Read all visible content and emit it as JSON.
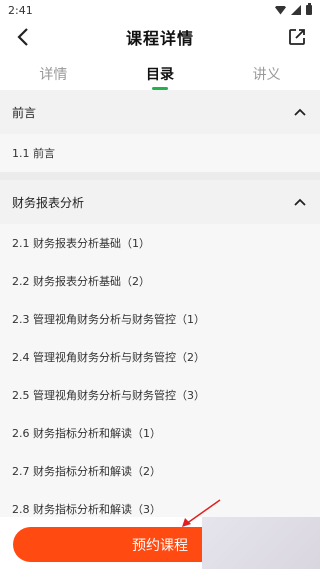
{
  "status": {
    "time": "2:41"
  },
  "header": {
    "title": "课程详情"
  },
  "tabs": [
    {
      "label": "详情"
    },
    {
      "label": "目录"
    },
    {
      "label": "讲义"
    }
  ],
  "sections": [
    {
      "title": "前言",
      "items": [
        "1.1 前言"
      ]
    },
    {
      "title": "财务报表分析",
      "items": [
        "2.1 财务报表分析基础（1）",
        "2.2 财务报表分析基础（2）",
        "2.3 管理视角财务分析与财务管控（1）",
        "2.4 管理视角财务分析与财务管控（2）",
        "2.5 管理视角财务分析与财务管控（3）",
        "2.6 财务指标分析和解读（1）",
        "2.7 财务指标分析和解读（2）",
        "2.8 财务指标分析和解读（3）"
      ]
    }
  ],
  "bottom": {
    "reserve_label": "预约课程"
  },
  "colors": {
    "accent": "#ff4a12",
    "tab_indicator": "#22b14c"
  }
}
